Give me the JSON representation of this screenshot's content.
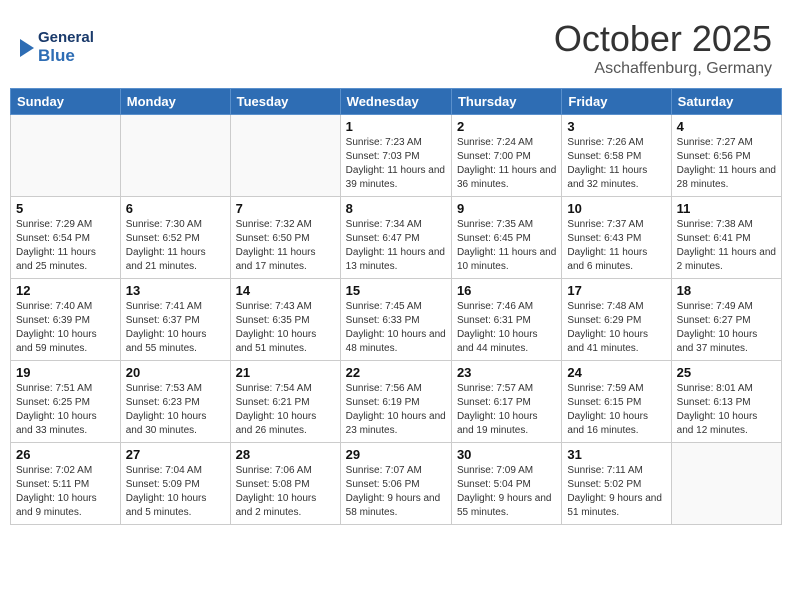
{
  "header": {
    "logo_general": "General",
    "logo_blue": "Blue",
    "month": "October 2025",
    "location": "Aschaffenburg, Germany"
  },
  "weekdays": [
    "Sunday",
    "Monday",
    "Tuesday",
    "Wednesday",
    "Thursday",
    "Friday",
    "Saturday"
  ],
  "weeks": [
    [
      {
        "num": "",
        "sunrise": "",
        "sunset": "",
        "daylight": ""
      },
      {
        "num": "",
        "sunrise": "",
        "sunset": "",
        "daylight": ""
      },
      {
        "num": "",
        "sunrise": "",
        "sunset": "",
        "daylight": ""
      },
      {
        "num": "1",
        "sunrise": "Sunrise: 7:23 AM",
        "sunset": "Sunset: 7:03 PM",
        "daylight": "Daylight: 11 hours and 39 minutes."
      },
      {
        "num": "2",
        "sunrise": "Sunrise: 7:24 AM",
        "sunset": "Sunset: 7:00 PM",
        "daylight": "Daylight: 11 hours and 36 minutes."
      },
      {
        "num": "3",
        "sunrise": "Sunrise: 7:26 AM",
        "sunset": "Sunset: 6:58 PM",
        "daylight": "Daylight: 11 hours and 32 minutes."
      },
      {
        "num": "4",
        "sunrise": "Sunrise: 7:27 AM",
        "sunset": "Sunset: 6:56 PM",
        "daylight": "Daylight: 11 hours and 28 minutes."
      }
    ],
    [
      {
        "num": "5",
        "sunrise": "Sunrise: 7:29 AM",
        "sunset": "Sunset: 6:54 PM",
        "daylight": "Daylight: 11 hours and 25 minutes."
      },
      {
        "num": "6",
        "sunrise": "Sunrise: 7:30 AM",
        "sunset": "Sunset: 6:52 PM",
        "daylight": "Daylight: 11 hours and 21 minutes."
      },
      {
        "num": "7",
        "sunrise": "Sunrise: 7:32 AM",
        "sunset": "Sunset: 6:50 PM",
        "daylight": "Daylight: 11 hours and 17 minutes."
      },
      {
        "num": "8",
        "sunrise": "Sunrise: 7:34 AM",
        "sunset": "Sunset: 6:47 PM",
        "daylight": "Daylight: 11 hours and 13 minutes."
      },
      {
        "num": "9",
        "sunrise": "Sunrise: 7:35 AM",
        "sunset": "Sunset: 6:45 PM",
        "daylight": "Daylight: 11 hours and 10 minutes."
      },
      {
        "num": "10",
        "sunrise": "Sunrise: 7:37 AM",
        "sunset": "Sunset: 6:43 PM",
        "daylight": "Daylight: 11 hours and 6 minutes."
      },
      {
        "num": "11",
        "sunrise": "Sunrise: 7:38 AM",
        "sunset": "Sunset: 6:41 PM",
        "daylight": "Daylight: 11 hours and 2 minutes."
      }
    ],
    [
      {
        "num": "12",
        "sunrise": "Sunrise: 7:40 AM",
        "sunset": "Sunset: 6:39 PM",
        "daylight": "Daylight: 10 hours and 59 minutes."
      },
      {
        "num": "13",
        "sunrise": "Sunrise: 7:41 AM",
        "sunset": "Sunset: 6:37 PM",
        "daylight": "Daylight: 10 hours and 55 minutes."
      },
      {
        "num": "14",
        "sunrise": "Sunrise: 7:43 AM",
        "sunset": "Sunset: 6:35 PM",
        "daylight": "Daylight: 10 hours and 51 minutes."
      },
      {
        "num": "15",
        "sunrise": "Sunrise: 7:45 AM",
        "sunset": "Sunset: 6:33 PM",
        "daylight": "Daylight: 10 hours and 48 minutes."
      },
      {
        "num": "16",
        "sunrise": "Sunrise: 7:46 AM",
        "sunset": "Sunset: 6:31 PM",
        "daylight": "Daylight: 10 hours and 44 minutes."
      },
      {
        "num": "17",
        "sunrise": "Sunrise: 7:48 AM",
        "sunset": "Sunset: 6:29 PM",
        "daylight": "Daylight: 10 hours and 41 minutes."
      },
      {
        "num": "18",
        "sunrise": "Sunrise: 7:49 AM",
        "sunset": "Sunset: 6:27 PM",
        "daylight": "Daylight: 10 hours and 37 minutes."
      }
    ],
    [
      {
        "num": "19",
        "sunrise": "Sunrise: 7:51 AM",
        "sunset": "Sunset: 6:25 PM",
        "daylight": "Daylight: 10 hours and 33 minutes."
      },
      {
        "num": "20",
        "sunrise": "Sunrise: 7:53 AM",
        "sunset": "Sunset: 6:23 PM",
        "daylight": "Daylight: 10 hours and 30 minutes."
      },
      {
        "num": "21",
        "sunrise": "Sunrise: 7:54 AM",
        "sunset": "Sunset: 6:21 PM",
        "daylight": "Daylight: 10 hours and 26 minutes."
      },
      {
        "num": "22",
        "sunrise": "Sunrise: 7:56 AM",
        "sunset": "Sunset: 6:19 PM",
        "daylight": "Daylight: 10 hours and 23 minutes."
      },
      {
        "num": "23",
        "sunrise": "Sunrise: 7:57 AM",
        "sunset": "Sunset: 6:17 PM",
        "daylight": "Daylight: 10 hours and 19 minutes."
      },
      {
        "num": "24",
        "sunrise": "Sunrise: 7:59 AM",
        "sunset": "Sunset: 6:15 PM",
        "daylight": "Daylight: 10 hours and 16 minutes."
      },
      {
        "num": "25",
        "sunrise": "Sunrise: 8:01 AM",
        "sunset": "Sunset: 6:13 PM",
        "daylight": "Daylight: 10 hours and 12 minutes."
      }
    ],
    [
      {
        "num": "26",
        "sunrise": "Sunrise: 7:02 AM",
        "sunset": "Sunset: 5:11 PM",
        "daylight": "Daylight: 10 hours and 9 minutes."
      },
      {
        "num": "27",
        "sunrise": "Sunrise: 7:04 AM",
        "sunset": "Sunset: 5:09 PM",
        "daylight": "Daylight: 10 hours and 5 minutes."
      },
      {
        "num": "28",
        "sunrise": "Sunrise: 7:06 AM",
        "sunset": "Sunset: 5:08 PM",
        "daylight": "Daylight: 10 hours and 2 minutes."
      },
      {
        "num": "29",
        "sunrise": "Sunrise: 7:07 AM",
        "sunset": "Sunset: 5:06 PM",
        "daylight": "Daylight: 9 hours and 58 minutes."
      },
      {
        "num": "30",
        "sunrise": "Sunrise: 7:09 AM",
        "sunset": "Sunset: 5:04 PM",
        "daylight": "Daylight: 9 hours and 55 minutes."
      },
      {
        "num": "31",
        "sunrise": "Sunrise: 7:11 AM",
        "sunset": "Sunset: 5:02 PM",
        "daylight": "Daylight: 9 hours and 51 minutes."
      },
      {
        "num": "",
        "sunrise": "",
        "sunset": "",
        "daylight": ""
      }
    ]
  ]
}
